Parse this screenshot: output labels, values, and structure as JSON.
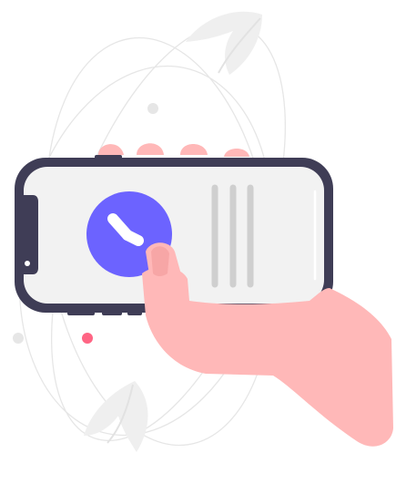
{
  "illustration": {
    "subject": "hand-holding-phone-with-clock-icon",
    "icons": {
      "clock": "clock-icon",
      "leaf_top": "leaf-icon",
      "leaf_bottom": "leaf-icon"
    },
    "colors": {
      "accent": "#6c63ff",
      "skin": "#ffb8b8",
      "skin_outline": "#f29a9a",
      "phone_frame": "#3f3d56",
      "screen": "#f2f2f2",
      "bars": "#cfcfcf",
      "decor": "#e6e6e6",
      "dot_red": "#ff6584"
    }
  }
}
